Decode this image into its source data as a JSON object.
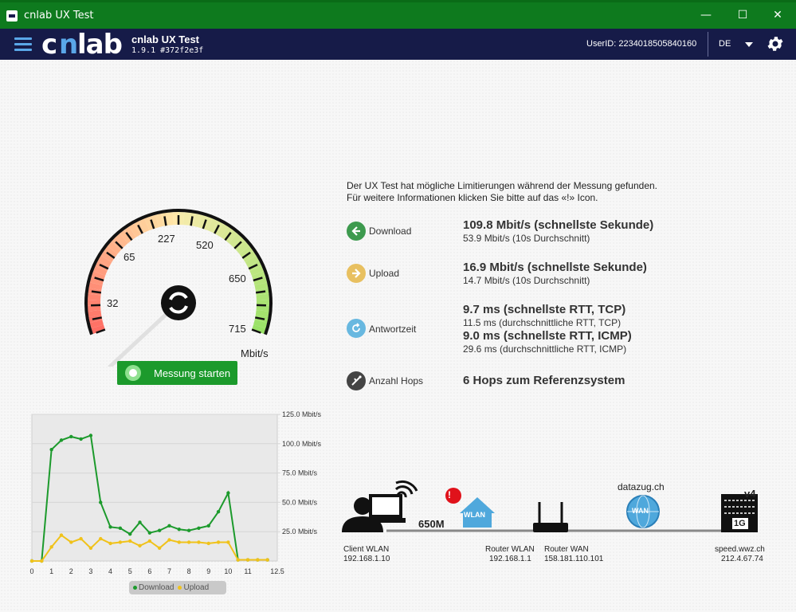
{
  "window": {
    "title": "cnlab UX Test",
    "minimize": "—",
    "maximize": "☐",
    "close": "✕"
  },
  "header": {
    "logo": "cnlab",
    "app_name": "cnlab UX Test",
    "version": "1.9.1 #372f2e3f",
    "user_id": "UserID: 2234018505840160",
    "language": "DE"
  },
  "gauge": {
    "labels": [
      "32",
      "65",
      "227",
      "520",
      "650",
      "715"
    ],
    "unit": "Mbit/s",
    "start_button": "Messung starten"
  },
  "notice": {
    "line1": "Der UX Test hat mögliche Limitierungen während der Messung gefunden.",
    "line2": "Für weitere Informationen klicken Sie bitte auf das «!» Icon."
  },
  "results": {
    "download": {
      "label": "Download",
      "main": "109.8 Mbit/s (schnellste Sekunde)",
      "sub": "53.9 Mbit/s (10s Durchschnitt)"
    },
    "upload": {
      "label": "Upload",
      "main": "16.9 Mbit/s (schnellste Sekunde)",
      "sub": "14.7 Mbit/s (10s Durchschnitt)"
    },
    "latency": {
      "label": "Antwortzeit",
      "main1": "9.7 ms (schnellste RTT, TCP)",
      "sub1": "11.5 ms (durchschnittliche RTT, TCP)",
      "main2": "9.0 ms (schnellste RTT, ICMP)",
      "sub2": "29.6 ms (durchschnittliche RTT, ICMP)"
    },
    "hops": {
      "label": "Anzahl Hops",
      "main": "6 Hops zum Referenzsystem"
    }
  },
  "network": {
    "client_label": "Client WLAN",
    "client_ip": "192.168.1.10",
    "link_speed": "650M",
    "router_wlan_label": "Router WLAN",
    "router_wlan_ip": "192.168.1.1",
    "router_wan_label": "Router WAN",
    "router_wan_ip": "158.181.110.101",
    "provider": "datazug.ch",
    "server_label": "speed.wwz.ch",
    "server_ip": "212.4.67.74",
    "wlan_badge": "WLAN",
    "wan_badge": "WAN",
    "server_badge_v4": "v4",
    "server_badge_1g": "1G",
    "warning": "!"
  },
  "chart_data": {
    "type": "line",
    "x": [
      0,
      0.5,
      1,
      1.5,
      2,
      2.5,
      3,
      3.5,
      4,
      4.5,
      5,
      5.5,
      6,
      6.5,
      7,
      7.5,
      8,
      8.5,
      9,
      9.5,
      10,
      10.5,
      11,
      11.5,
      12
    ],
    "series": [
      {
        "name": "Download",
        "color": "#1c9a2c",
        "values": [
          0,
          0,
          95,
          103,
          106,
          104,
          107,
          50,
          29,
          28,
          23,
          33,
          24,
          26,
          30,
          27,
          26,
          28,
          30,
          42,
          58,
          1,
          1,
          1,
          1
        ]
      },
      {
        "name": "Upload",
        "color": "#f0c21a",
        "values": [
          0,
          0,
          12,
          22,
          16,
          19,
          11,
          19,
          15,
          16,
          17,
          13,
          17,
          11,
          18,
          16,
          16,
          16,
          15,
          16,
          16,
          1,
          1,
          1,
          1
        ]
      }
    ],
    "x_ticks": [
      "0",
      "1",
      "2",
      "3",
      "4",
      "5",
      "6",
      "7",
      "8",
      "9",
      "10",
      "11",
      "12.5"
    ],
    "y_ticks": [
      "125.0 Mbit/s",
      "100.0 Mbit/s",
      "75.0 Mbit/s",
      "50.0 Mbit/s",
      "25.0 Mbit/s"
    ],
    "xlim": [
      0,
      12.5
    ],
    "ylim": [
      0,
      125
    ],
    "legend": [
      "Download",
      "Upload"
    ],
    "legend_position": "bottom"
  }
}
